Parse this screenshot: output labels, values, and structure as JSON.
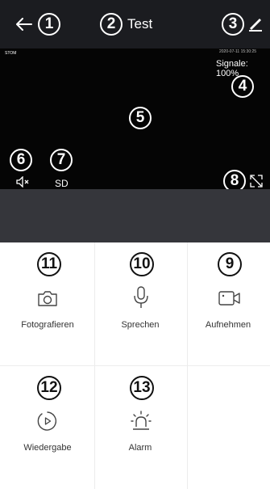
{
  "header": {
    "title": "Test",
    "back_icon": "arrow-left-icon",
    "edit_icon": "pencil-icon",
    "badges": {
      "back": "1",
      "title": "2",
      "edit": "3"
    }
  },
  "video": {
    "timestamp_left": "STOM",
    "timestamp_right": "2020-07-11 15:30:25",
    "signal_text": "Signale: 100%",
    "sd_label": "SD",
    "mute_icon": "speaker-mute-icon",
    "fullscreen_icon": "fullscreen-icon",
    "badges": {
      "signal": "4",
      "video": "5",
      "mute": "6",
      "sd": "7",
      "fullscreen": "8"
    }
  },
  "actions": [
    {
      "label": "Fotografieren",
      "icon": "camera-icon",
      "badge": "11"
    },
    {
      "label": "Sprechen",
      "icon": "microphone-icon",
      "badge": "10"
    },
    {
      "label": "Aufnehmen",
      "icon": "video-record-icon",
      "badge": "9"
    },
    {
      "label": "Wiedergabe",
      "icon": "playback-icon",
      "badge": "12"
    },
    {
      "label": "Alarm",
      "icon": "alarm-icon",
      "badge": "13"
    }
  ],
  "colors": {
    "header_bg": "#1b1c20",
    "video_bg": "#050505",
    "bar_bg": "#35363b",
    "accent": "#ffffff"
  }
}
